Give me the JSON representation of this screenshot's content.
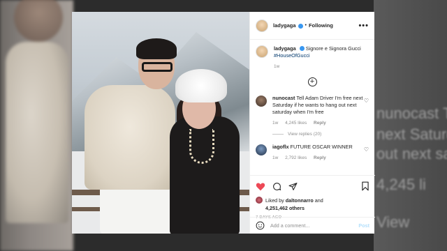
{
  "background": {
    "ghost_lines": [
      "nunocast T",
      "next Saturd",
      "out next sat",
      "4,245 li",
      "View"
    ]
  },
  "post": {
    "username": "ladygaga",
    "follow_label": "Following",
    "more_label": "•••",
    "caption_user": "ladygaga",
    "caption_text": "Signore e Signora Gucci",
    "caption_tag": "#HouseOfGucci",
    "caption_age": "1w",
    "comments": [
      {
        "user": "nunocast",
        "text": "Tell Adam Driver I'm free next Saturday if he wants to hang out next saturday when I'm free",
        "age": "1w",
        "likes": "4,245 likes",
        "reply": "Reply",
        "view_replies": "View replies (20)"
      },
      {
        "user": "iagoflx",
        "text": "FUTURE OSCAR WINNER",
        "age": "1w",
        "likes": "2,792 likes",
        "reply": "Reply"
      }
    ],
    "liked_by_prefix": "Liked by",
    "liked_by_user": "daltonnarro",
    "liked_by_and": "and",
    "likes_others": "4,251,462 others",
    "date": "7 DAYS AGO",
    "add_comment_placeholder": "Add a comment...",
    "post_label": "Post",
    "colors": {
      "heart": "#ed4956",
      "verified": "#3897f0",
      "post_button": "#b2dffc"
    }
  }
}
